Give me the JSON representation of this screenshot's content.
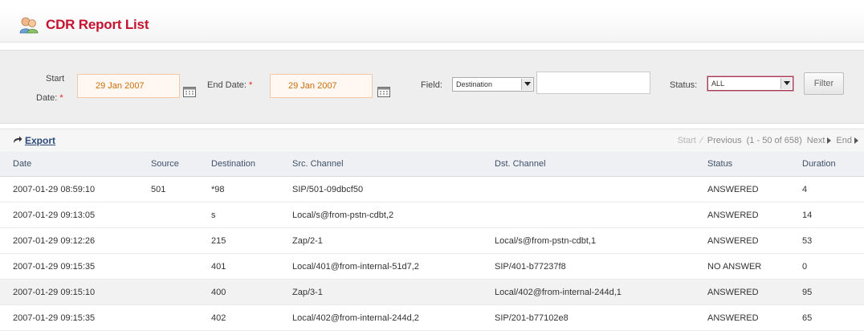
{
  "title": "CDR Report List",
  "filter": {
    "start_label_1": "Start",
    "start_label_2": "Date:",
    "required_mark": "*",
    "start_value": "29 Jan 2007",
    "end_label": "End Date:",
    "end_value": "29 Jan 2007",
    "field_label": "Field:",
    "field_value": "Destination",
    "field_text": "",
    "status_label": "Status:",
    "status_value": "ALL",
    "filter_button": "Filter"
  },
  "toolbar": {
    "export_label": "Export",
    "pager_start": "Start",
    "pager_previous": "Previous",
    "pager_info": "(1 - 50 of 658)",
    "pager_next": "Next",
    "pager_end": "End"
  },
  "table": {
    "columns": [
      "Date",
      "Source",
      "Destination",
      "Src. Channel",
      "Dst. Channel",
      "Status",
      "Duration"
    ],
    "rows": [
      [
        "2007-01-29 08:59:10",
        "501",
        "*98",
        "SIP/501-09dbcf50",
        "",
        "ANSWERED",
        "4"
      ],
      [
        "2007-01-29 09:13:05",
        "",
        "s",
        "Local/s@from-pstn-cdbt,2",
        "",
        "ANSWERED",
        "14"
      ],
      [
        "2007-01-29 09:12:26",
        "",
        "215",
        "Zap/2-1",
        "Local/s@from-pstn-cdbt,1",
        "ANSWERED",
        "53"
      ],
      [
        "2007-01-29 09:15:35",
        "",
        "401",
        "Local/401@from-internal-51d7,2",
        "SIP/401-b77237f8",
        "NO ANSWER",
        "0"
      ],
      [
        "2007-01-29 09:15:10",
        "",
        "400",
        "Zap/3-1",
        "Local/402@from-internal-244d,1",
        "ANSWERED",
        "95"
      ],
      [
        "2007-01-29 09:15:35",
        "",
        "402",
        "Local/402@from-internal-244d,2",
        "SIP/201-b77102e8",
        "ANSWERED",
        "65"
      ]
    ]
  },
  "colors": {
    "title": "#c4122f",
    "date_text": "#c8700b",
    "required": "#e0202a",
    "link": "#2b4a7a"
  },
  "icons": [
    "users-icon",
    "calendar-icon",
    "export-arrow-icon",
    "triangle-right-icon"
  ]
}
